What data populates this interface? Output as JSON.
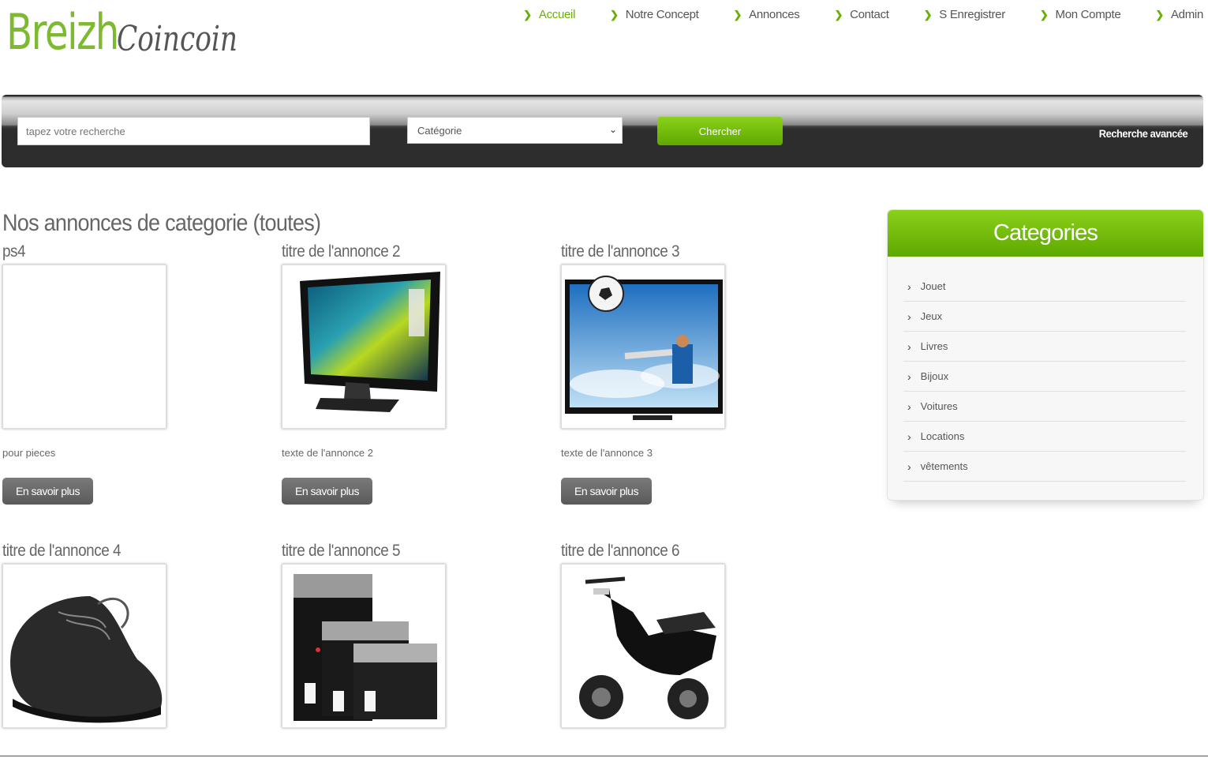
{
  "logo": {
    "part1": "Breizh",
    "part2": "Coincoin"
  },
  "nav": [
    {
      "label": "Accueil",
      "active": true
    },
    {
      "label": "Notre Concept"
    },
    {
      "label": "Annonces"
    },
    {
      "label": "Contact"
    },
    {
      "label": "S Enregistrer"
    },
    {
      "label": "Mon Compte"
    },
    {
      "label": "Admin"
    }
  ],
  "search": {
    "placeholder": "tapez votre recherche",
    "category_selected": "Catégorie",
    "submit_label": "Chercher",
    "advanced_label": "Recherche avancée"
  },
  "main": {
    "title": "Nos annonces de categorie (toutes)",
    "more_label": "En savoir plus",
    "listings": [
      {
        "title": "ps4",
        "text": "pour pieces",
        "image": "blank"
      },
      {
        "title": "titre de l'annonce 2",
        "text": "texte de l'annonce 2",
        "image": "monitor"
      },
      {
        "title": "titre de l'annonce 3",
        "text": "texte de l'annonce 3",
        "image": "tv-football"
      },
      {
        "title": "titre de l'annonce 4",
        "text": "",
        "image": "shoe"
      },
      {
        "title": "titre de l'annonce 5",
        "text": "",
        "image": "pouches"
      },
      {
        "title": "titre de l'annonce 6",
        "text": "",
        "image": "scooter"
      }
    ]
  },
  "sidebar": {
    "title": "Categories",
    "items": [
      {
        "label": "Jouet"
      },
      {
        "label": "Jeux"
      },
      {
        "label": "Livres"
      },
      {
        "label": "Bijoux"
      },
      {
        "label": "Voitures"
      },
      {
        "label": "Locations"
      },
      {
        "label": "vêtements"
      }
    ]
  },
  "colors": {
    "accent": "#6ab000",
    "button_gray": "#666666",
    "bar_dark": "#2d2d2d"
  }
}
